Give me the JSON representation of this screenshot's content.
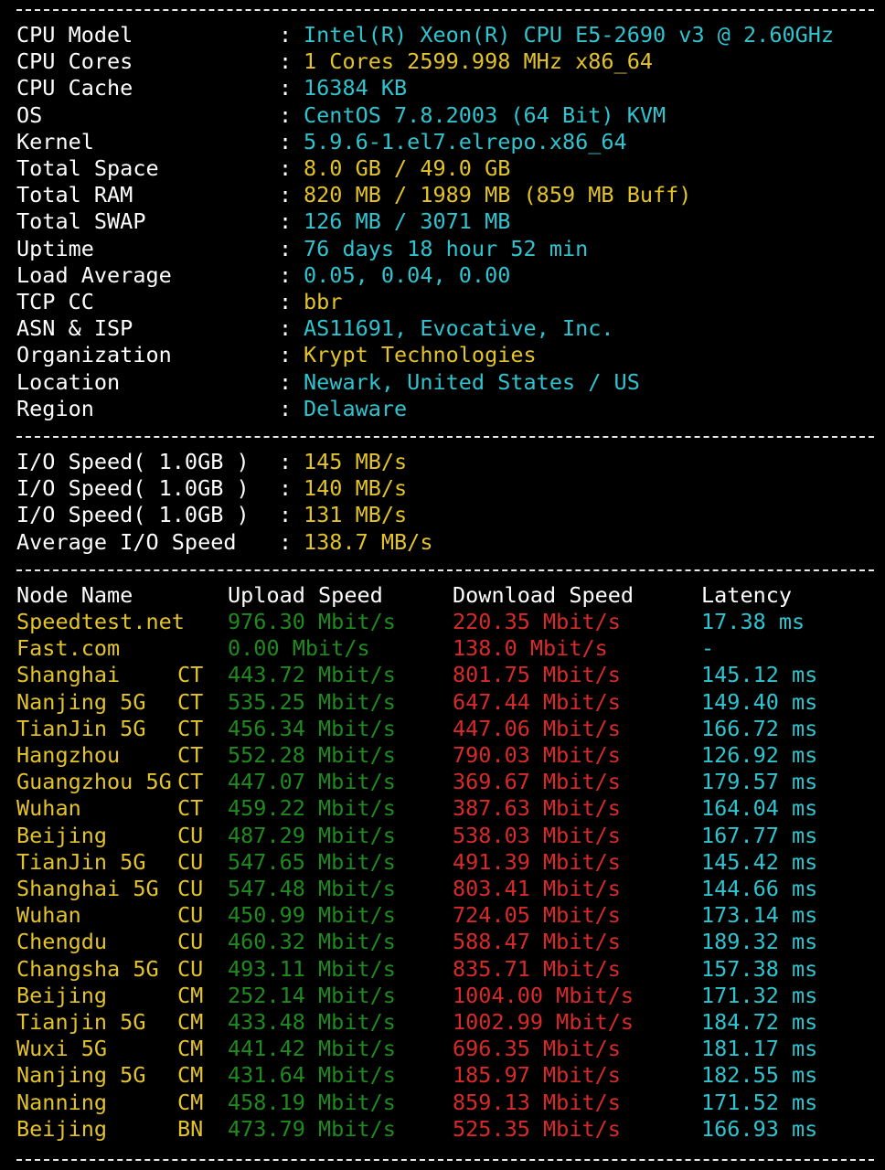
{
  "colors": {
    "background": "#000000",
    "label": "#ffffff",
    "value_cyan": "#2fc4cf",
    "value_yellow": "#e3c32a",
    "upload_green": "#1f8a1f",
    "download_red": "#d82a2a",
    "latency_cyan": "#2fc4cf",
    "node_yellow": "#e3c32a",
    "separator": "#e8e8e8"
  },
  "colon": ":",
  "system_info": [
    {
      "label": "CPU Model",
      "value": "Intel(R) Xeon(R) CPU E5-2690 v3 @ 2.60GHz",
      "color": "cyan"
    },
    {
      "label": "CPU Cores",
      "value": "1 Cores 2599.998 MHz x86_64",
      "color": "yellow"
    },
    {
      "label": "CPU Cache",
      "value": "16384 KB",
      "color": "cyan"
    },
    {
      "label": "OS",
      "value": "CentOS 7.8.2003 (64 Bit) KVM",
      "color": "cyan"
    },
    {
      "label": "Kernel",
      "value": "5.9.6-1.el7.elrepo.x86_64",
      "color": "cyan"
    },
    {
      "label": "Total Space",
      "value": "8.0 GB / 49.0 GB",
      "color": "yellow"
    },
    {
      "label": "Total RAM",
      "value": "820 MB / 1989 MB (859 MB Buff)",
      "color": "yellow"
    },
    {
      "label": "Total SWAP",
      "value": "126 MB / 3071 MB",
      "color": "cyan"
    },
    {
      "label": "Uptime",
      "value": "76 days 18 hour 52 min",
      "color": "cyan"
    },
    {
      "label": "Load Average",
      "value": "0.05, 0.04, 0.00",
      "color": "cyan"
    },
    {
      "label": "TCP CC",
      "value": "bbr",
      "color": "yellow"
    },
    {
      "label": "ASN & ISP",
      "value": "AS11691, Evocative, Inc.",
      "color": "cyan"
    },
    {
      "label": "Organization",
      "value": "Krypt Technologies",
      "color": "yellow"
    },
    {
      "label": "Location",
      "value": "Newark, United States / US",
      "color": "cyan"
    },
    {
      "label": "Region",
      "value": "Delaware",
      "color": "cyan"
    }
  ],
  "io_info": [
    {
      "label": "I/O Speed( 1.0GB )",
      "value": "145 MB/s"
    },
    {
      "label": "I/O Speed( 1.0GB )",
      "value": "140 MB/s"
    },
    {
      "label": "I/O Speed( 1.0GB )",
      "value": "131 MB/s"
    },
    {
      "label": "Average I/O Speed",
      "value": "138.7 MB/s"
    }
  ],
  "speed_table": {
    "headers": {
      "node": "Node Name",
      "upload": "Upload Speed",
      "download": "Download Speed",
      "latency": "Latency"
    },
    "rows": [
      {
        "node": "Speedtest.net",
        "op": "",
        "up": "976.30 Mbit/s",
        "down": "220.35 Mbit/s",
        "lat": "17.38 ms"
      },
      {
        "node": "Fast.com",
        "op": "",
        "up": "0.00 Mbit/s",
        "down": "138.0 Mbit/s",
        "lat": "-"
      },
      {
        "node": "Shanghai",
        "op": "CT",
        "up": "443.72 Mbit/s",
        "down": "801.75 Mbit/s",
        "lat": "145.12 ms"
      },
      {
        "node": "Nanjing 5G",
        "op": "CT",
        "up": "535.25 Mbit/s",
        "down": "647.44 Mbit/s",
        "lat": "149.40 ms"
      },
      {
        "node": "TianJin 5G",
        "op": "CT",
        "up": "456.34 Mbit/s",
        "down": "447.06 Mbit/s",
        "lat": "166.72 ms"
      },
      {
        "node": "Hangzhou",
        "op": "CT",
        "up": "552.28 Mbit/s",
        "down": "790.03 Mbit/s",
        "lat": "126.92 ms"
      },
      {
        "node": "Guangzhou 5G",
        "op": "CT",
        "up": "447.07 Mbit/s",
        "down": "369.67 Mbit/s",
        "lat": "179.57 ms"
      },
      {
        "node": "Wuhan",
        "op": "CT",
        "up": "459.22 Mbit/s",
        "down": "387.63 Mbit/s",
        "lat": "164.04 ms"
      },
      {
        "node": "Beijing",
        "op": "CU",
        "up": "487.29 Mbit/s",
        "down": "538.03 Mbit/s",
        "lat": "167.77 ms"
      },
      {
        "node": "TianJin 5G",
        "op": "CU",
        "up": "547.65 Mbit/s",
        "down": "491.39 Mbit/s",
        "lat": "145.42 ms"
      },
      {
        "node": "Shanghai 5G",
        "op": "CU",
        "up": "547.48 Mbit/s",
        "down": "803.41 Mbit/s",
        "lat": "144.66 ms"
      },
      {
        "node": "Wuhan",
        "op": "CU",
        "up": "450.99 Mbit/s",
        "down": "724.05 Mbit/s",
        "lat": "173.14 ms"
      },
      {
        "node": "Chengdu",
        "op": "CU",
        "up": "460.32 Mbit/s",
        "down": "588.47 Mbit/s",
        "lat": "189.32 ms"
      },
      {
        "node": "Changsha 5G",
        "op": "CU",
        "up": "493.11 Mbit/s",
        "down": "835.71 Mbit/s",
        "lat": "157.38 ms"
      },
      {
        "node": "Beijing",
        "op": "CM",
        "up": "252.14 Mbit/s",
        "down": "1004.00 Mbit/s",
        "lat": "171.32 ms"
      },
      {
        "node": "Tianjin 5G",
        "op": "CM",
        "up": "433.48 Mbit/s",
        "down": "1002.99 Mbit/s",
        "lat": "184.72 ms"
      },
      {
        "node": "Wuxi 5G",
        "op": "CM",
        "up": "441.42 Mbit/s",
        "down": "696.35 Mbit/s",
        "lat": "181.17 ms"
      },
      {
        "node": "Nanjing 5G",
        "op": "CM",
        "up": "431.64 Mbit/s",
        "down": "185.97 Mbit/s",
        "lat": "182.55 ms"
      },
      {
        "node": "Nanning",
        "op": "CM",
        "up": "458.19 Mbit/s",
        "down": "859.13 Mbit/s",
        "lat": "171.52 ms"
      },
      {
        "node": "Beijing",
        "op": "BN",
        "up": "473.79 Mbit/s",
        "down": "525.35 Mbit/s",
        "lat": "166.93 ms"
      }
    ]
  }
}
